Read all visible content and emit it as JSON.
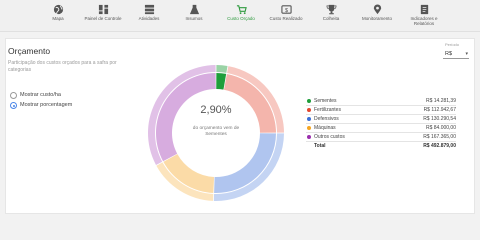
{
  "nav": {
    "items": [
      {
        "label": "Mapa",
        "icon": "globe-icon"
      },
      {
        "label": "Painel de Controle",
        "icon": "dashboard-icon"
      },
      {
        "label": "Atividades",
        "icon": "activities-icon"
      },
      {
        "label": "Insumos",
        "icon": "flask-icon"
      },
      {
        "label": "Custo Orçado",
        "icon": "cart-icon"
      },
      {
        "label": "Custo Realizado",
        "icon": "money-icon"
      },
      {
        "label": "Colheita",
        "icon": "trophy-icon"
      },
      {
        "label": "Monitoramento",
        "icon": "location-pin-icon"
      },
      {
        "label": "Indicadores e Relatórios",
        "icon": "report-icon"
      }
    ],
    "active_index": 4,
    "active_color": "#2e9a3e"
  },
  "card": {
    "title": "Orçamento",
    "subtitle": "Participação dos custos orçados para a safra por categorias",
    "period_label": "Período",
    "period_value": "R$",
    "radio_cost": "Mostrar custo/ha",
    "radio_percent": "Mostrar porcentagem",
    "selected_radio": "percent"
  },
  "donut": {
    "center_value": "2,90%",
    "center_caption": "do orçamento vem de Sementes"
  },
  "legend": {
    "rows": [
      {
        "name": "Sementes",
        "value": "R$ 14.281,39",
        "color": "#1e9e3a"
      },
      {
        "name": "Fertilizantes",
        "value": "R$ 112.942,67",
        "color": "#e3472f"
      },
      {
        "name": "Defensivos",
        "value": "R$ 130.290,54",
        "color": "#3a6fd8"
      },
      {
        "name": "Máquinas",
        "value": "R$ 84.000,00",
        "color": "#f5a623"
      },
      {
        "name": "Outros custos",
        "value": "R$ 167.365,00",
        "color": "#9b2fae"
      }
    ],
    "total_label": "Total",
    "total_value": "R$ 492.879,00"
  },
  "chart_data": {
    "type": "pie",
    "categories": [
      "Sementes",
      "Fertilizantes",
      "Defensivos",
      "Máquinas",
      "Outros custos"
    ],
    "values": [
      14281.39,
      112942.67,
      130290.54,
      84000.0,
      167365.0
    ],
    "colors": [
      "#1e9e3a",
      "#e3472f",
      "#3a6fd8",
      "#f5a623",
      "#9b2fae"
    ],
    "highlighted": "Sementes"
  }
}
